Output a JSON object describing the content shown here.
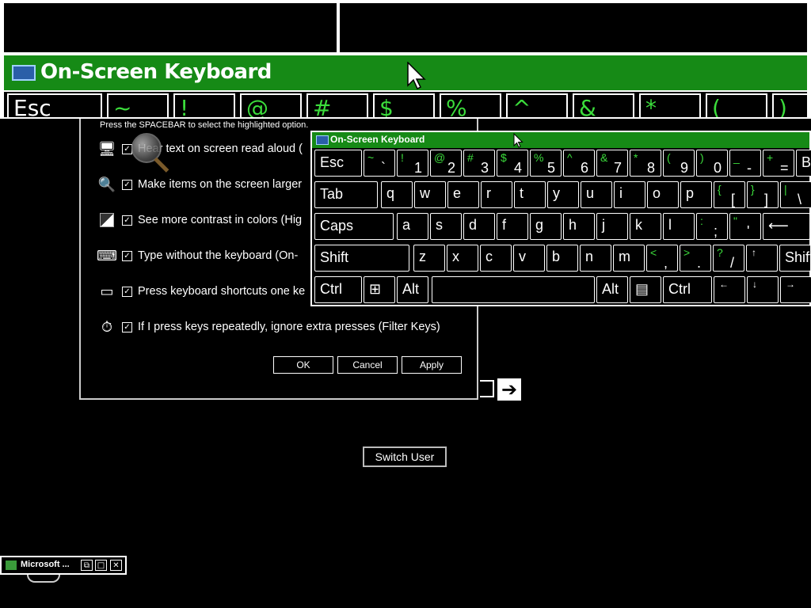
{
  "magnifier": {
    "title": "On-Screen Keyboard",
    "keys": [
      "Esc",
      "~",
      "!",
      "@",
      "#",
      "$",
      "%",
      "^",
      "&",
      "*",
      "(",
      ")"
    ]
  },
  "ease_panel": {
    "hint": "Press the SPACEBAR to select the highlighted option.",
    "options": [
      {
        "icon": "narrator-icon",
        "text": "Hear text on screen read aloud (",
        "checked": true
      },
      {
        "icon": "magnifier-icon",
        "text": "Make items on the screen larger",
        "checked": true
      },
      {
        "icon": "contrast-icon",
        "text": "See more contrast in colors (Hig",
        "checked": true
      },
      {
        "icon": "keyboard-icon",
        "text": "Type without the keyboard (On-",
        "checked": true
      },
      {
        "icon": "sticky-keys-icon",
        "text": "Press keyboard shortcuts one ke",
        "checked": true
      },
      {
        "icon": "stopwatch-icon",
        "text": "If I press keys repeatedly, ignore extra presses (Filter Keys)",
        "checked": true
      }
    ],
    "ok_label": "OK",
    "cancel_label": "Cancel",
    "apply_label": "Apply"
  },
  "osk": {
    "title": "On-Screen Keyboard",
    "row1": [
      {
        "word": "Esc"
      },
      {
        "sub": "~",
        "low": "`"
      },
      {
        "sub": "!",
        "low": "1"
      },
      {
        "sub": "@",
        "low": "2"
      },
      {
        "sub": "#",
        "low": "3"
      },
      {
        "sub": "$",
        "low": "4"
      },
      {
        "sub": "%",
        "low": "5"
      },
      {
        "sub": "^",
        "low": "6"
      },
      {
        "sub": "&",
        "low": "7"
      },
      {
        "sub": "*",
        "low": "8"
      },
      {
        "sub": "(",
        "low": "9"
      },
      {
        "sub": ")",
        "low": "0"
      },
      {
        "sub": "_",
        "low": "-"
      },
      {
        "sub": "+",
        "low": "="
      },
      {
        "word": "Bk"
      }
    ],
    "row2": [
      {
        "word": "Tab"
      },
      {
        "main": "q"
      },
      {
        "main": "w"
      },
      {
        "main": "e"
      },
      {
        "main": "r"
      },
      {
        "main": "t"
      },
      {
        "main": "y"
      },
      {
        "main": "u"
      },
      {
        "main": "i"
      },
      {
        "main": "o"
      },
      {
        "main": "p"
      },
      {
        "sub": "{",
        "low": "["
      },
      {
        "sub": "}",
        "low": "]"
      },
      {
        "sub": "|",
        "low": "\\"
      }
    ],
    "row3": [
      {
        "word": "Caps"
      },
      {
        "main": "a"
      },
      {
        "main": "s"
      },
      {
        "main": "d"
      },
      {
        "main": "f"
      },
      {
        "main": "g"
      },
      {
        "main": "h"
      },
      {
        "main": "j"
      },
      {
        "main": "k"
      },
      {
        "main": "l"
      },
      {
        "sub": ":",
        "low": ";"
      },
      {
        "sub": "\"",
        "low": "'"
      },
      {
        "word": "⟵"
      }
    ],
    "row4": [
      {
        "word": "Shift"
      },
      {
        "main": "z"
      },
      {
        "main": "x"
      },
      {
        "main": "c"
      },
      {
        "main": "v"
      },
      {
        "main": "b"
      },
      {
        "main": "n"
      },
      {
        "main": "m"
      },
      {
        "sub": "<",
        "low": ","
      },
      {
        "sub": ">",
        "low": "."
      },
      {
        "sub": "?",
        "low": "/"
      },
      {
        "arrow": "↑"
      },
      {
        "word": "Shift"
      }
    ],
    "row5": [
      {
        "word": "Ctrl"
      },
      {
        "word": "⊞"
      },
      {
        "word": "Alt"
      },
      {
        "word": ""
      },
      {
        "word": "Alt"
      },
      {
        "word": "▤"
      },
      {
        "word": "Ctrl"
      },
      {
        "arrow": "←"
      },
      {
        "arrow": "↓"
      },
      {
        "arrow": "→"
      }
    ]
  },
  "login": {
    "arrow": "➔",
    "switch_user": "Switch User"
  },
  "taskbar": {
    "label": "Microsoft ...",
    "restore": "⧉",
    "maximize": "□",
    "close": "✕"
  }
}
